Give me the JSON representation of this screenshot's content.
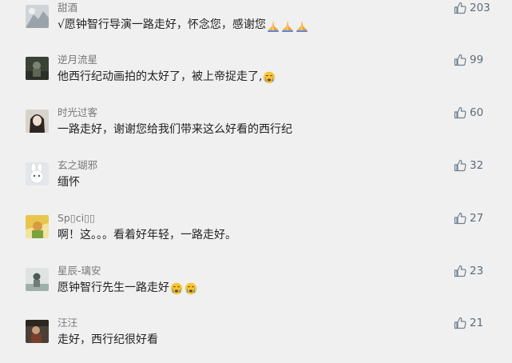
{
  "comments": [
    {
      "username": "甜酒",
      "text": "√愿钟智行导演一路走好，怀念您，感谢您",
      "emojis": [
        "praying-hands",
        "praying-hands",
        "praying-hands"
      ],
      "likes": "203"
    },
    {
      "username": "逆月流星",
      "text": "他西行纪动画拍的太好了，被上帝捉走了,",
      "emojis": [
        "crying-face"
      ],
      "likes": "99"
    },
    {
      "username": "时光过客",
      "text": "一路走好，谢谢您给我们带来这么好看的西行纪",
      "emojis": [],
      "likes": "60"
    },
    {
      "username": "玄之瑚邪",
      "text": "缅怀",
      "emojis": [],
      "likes": "32"
    },
    {
      "username": "Sp▯ci▯▯",
      "text": "啊！这。。。看着好年轻，一路走好。",
      "emojis": [],
      "likes": "27"
    },
    {
      "username": "星辰-璃安",
      "text": "愿钟智行先生一路走好",
      "emojis": [
        "crying-face",
        "crying-face"
      ],
      "likes": "23"
    },
    {
      "username": "汪汪",
      "text": "走好，西行纪很好看",
      "emojis": [],
      "likes": "21"
    }
  ],
  "colors": {
    "background": "#f0f0f0",
    "username": "#777777",
    "content": "#222222",
    "like_icon": "#6f7f8f",
    "like_count": "#5c6b7a"
  }
}
